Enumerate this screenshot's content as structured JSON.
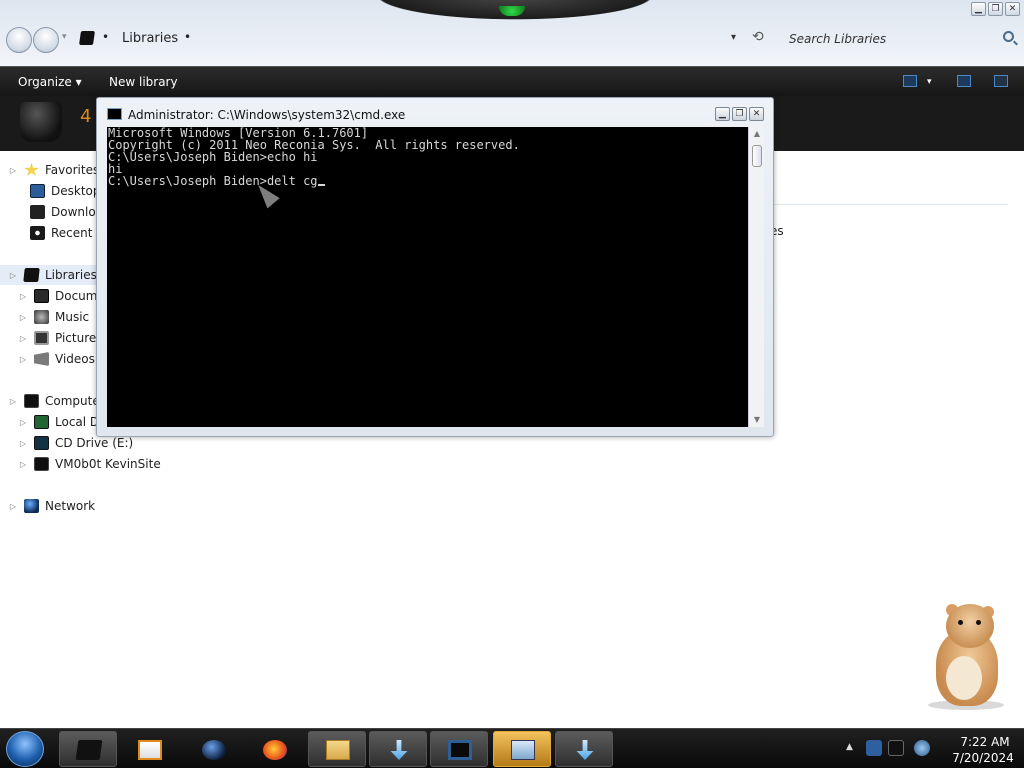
{
  "window_controls": {
    "minimize": "▁",
    "maximize": "❐",
    "close": "✕"
  },
  "address": {
    "separator": "•",
    "location": "Libraries",
    "trailing_separator": "•",
    "dropdown": "▾",
    "refresh_glyph": "⟲"
  },
  "search": {
    "placeholder": "Search Libraries"
  },
  "toolbar": {
    "organize_label": "Organize ▾",
    "new_library_label": "New library"
  },
  "library_header": {
    "count_fragment": "4"
  },
  "content": {
    "fragment": "es"
  },
  "nav": {
    "expand_glyph": "▷",
    "items": [
      {
        "label": "Favorites",
        "icon": "favorites-star-icon"
      },
      {
        "label": "Desktop",
        "icon": "desktop-icon"
      },
      {
        "label": "Downloa",
        "icon": "downloads-icon"
      },
      {
        "label": "Recent P",
        "icon": "recent-places-icon"
      },
      {
        "label": "Libraries",
        "icon": "libraries-icon"
      },
      {
        "label": "Docume",
        "icon": "documents-icon"
      },
      {
        "label": "Music",
        "icon": "music-icon"
      },
      {
        "label": "Pictures",
        "icon": "pictures-icon"
      },
      {
        "label": "Videos",
        "icon": "videos-icon"
      },
      {
        "label": "Computer",
        "icon": "computer-icon"
      },
      {
        "label": "Local Dis",
        "icon": "local-disk-icon"
      },
      {
        "label": "CD Drive (E:)",
        "icon": "cd-drive-icon"
      },
      {
        "label": "VM0b0t KevinSite",
        "icon": "network-drive-icon"
      },
      {
        "label": "Network",
        "icon": "network-icon"
      }
    ]
  },
  "cmd": {
    "title": "Administrator: C:\\Windows\\system32\\cmd.exe",
    "lines": [
      "Microsoft Windows [Version 6.1.7601]",
      "Copyright (c) 2011 Neo Reconia Sys.  All rights reserved.",
      "",
      "C:\\Users\\Joseph Biden>echo hi",
      "hi",
      "",
      "C:\\Users\\Joseph Biden>delt cg"
    ],
    "scroll_up": "▲",
    "scroll_down": "▼"
  },
  "taskbar": {
    "buttons": [
      {
        "icon": "libraries-explorer-icon"
      },
      {
        "icon": "media-player-icon"
      },
      {
        "icon": "globe-icon"
      },
      {
        "icon": "firefox-icon"
      },
      {
        "icon": "folder-icon"
      },
      {
        "icon": "download-arrow-icon"
      },
      {
        "icon": "cmd-screen-icon"
      },
      {
        "icon": "window-app-icon"
      },
      {
        "icon": "download-arrow-icon"
      }
    ],
    "clock_time": "7:22 AM",
    "clock_date": "7/20/2024",
    "tray_chevron": "▲"
  },
  "colors": {
    "toolbar_bg": "#1c1c1c",
    "library_count": "#d98a1e",
    "active_task": "#e0a940"
  }
}
